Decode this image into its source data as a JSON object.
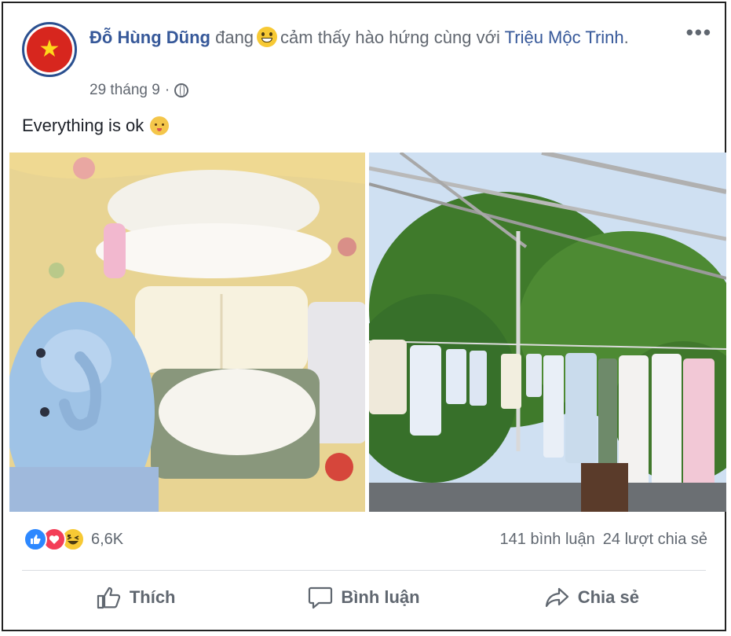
{
  "post": {
    "author": "Đỗ Hùng Dũng",
    "activity_verb": "đang",
    "feeling_text": "cảm thấy hào hứng cùng với",
    "tagged_user": "Triệu Mộc Trinh",
    "headline_end": ".",
    "timestamp": "29 tháng 9",
    "dot": "·",
    "text": "Everything is ok",
    "privacy_icon": "globe-icon",
    "feeling_icon": "grinning-face-icon",
    "text_icon": "baby-face-icon"
  },
  "photos": [
    {
      "name": "folded-baby-clothes-photo"
    },
    {
      "name": "baby-clothes-on-clothesline-photo"
    }
  ],
  "stats": {
    "reaction_icons": [
      "like-icon",
      "love-icon",
      "haha-icon"
    ],
    "reaction_count": "6,6K",
    "comments": "141 bình luận",
    "shares": "24 lượt chia sẻ"
  },
  "actions": {
    "like": "Thích",
    "comment": "Bình luận",
    "share": "Chia sẻ"
  },
  "colors": {
    "link": "#365899",
    "meta": "#616770",
    "like_blue": "#2d88ff",
    "love_red": "#f33e58",
    "haha_yellow": "#f7c934"
  }
}
